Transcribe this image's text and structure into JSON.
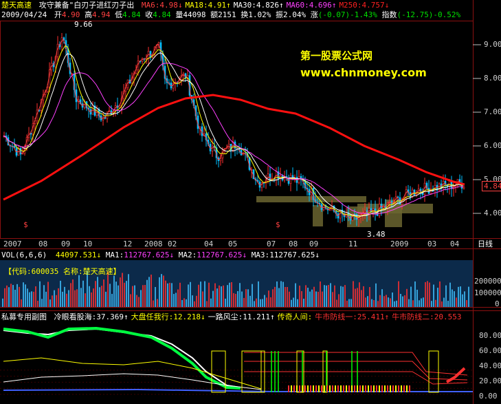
{
  "header": {
    "stock_name": "楚天高速",
    "strategy": "攻守兼备\"白刃子进红刃子出",
    "ma": [
      {
        "label": "MA6",
        "value": "4.98",
        "arrow": "↓",
        "color": "#ff4040"
      },
      {
        "label": "MA18",
        "value": "4.91",
        "arrow": "↑",
        "color": "#ffff00"
      },
      {
        "label": "MA30",
        "value": "4.826",
        "arrow": "↑",
        "color": "#ffffff"
      },
      {
        "label": "MA60",
        "value": "4.696",
        "arrow": "↑",
        "color": "#ff40ff"
      },
      {
        "label": "M250",
        "value": "4.757",
        "arrow": "↓",
        "color": "#ff2020"
      }
    ]
  },
  "quote": {
    "date": "2009/04/24",
    "open_label": "开",
    "open": "4.90",
    "high_label": "高",
    "high": "4.94",
    "low_label": "低",
    "low": "4.84",
    "close_label": "收",
    "close": "4.84",
    "vol_label": "量",
    "vol": "44098",
    "amt_label": "额",
    "amt": "2151",
    "turn_label": "换",
    "turn": "1.02%",
    "amp_label": "振",
    "amp": "2.04%",
    "chg_label": "涨",
    "chg": "(-0.07)-1.43%",
    "idx_label": "指数",
    "idx": "(-12.75)-0.52%"
  },
  "watermark": {
    "line1": "第一股票公式网",
    "line2": "www.chnmoney.com"
  },
  "price_axis": {
    "ticks": [
      "9.00",
      "8.00",
      "7.00",
      "6.00",
      "5.00",
      "4.00"
    ],
    "current": "4.84",
    "high_marker": "9.66",
    "low_marker": "3.48",
    "dollar_marker": "$"
  },
  "time_axis": {
    "labels": [
      "2007",
      "08",
      "09",
      "10",
      "12",
      "2008",
      "02",
      "04",
      "05",
      "07",
      "08",
      "09",
      "11",
      "2009",
      "03",
      "04"
    ],
    "period": "日线"
  },
  "volume": {
    "header_label": "VOL(6,6,6)",
    "value": "44097.531",
    "ma1_label": "MA1:",
    "ma1": "112767.625",
    "ma2_label": "MA2:",
    "ma2": "112767.625",
    "ma3_label": "MA3:",
    "ma3": "112767.625",
    "info": "【代码:600035 名称:楚天高速】",
    "axis": [
      "200000",
      "100000",
      "0"
    ]
  },
  "subchart": {
    "title": "私募专用副图",
    "items": [
      {
        "label": "冷眼看股海",
        "value": "37.369",
        "arrow": "↑",
        "color": "#ffffff"
      },
      {
        "label": "大盘任我行",
        "value": "12.218",
        "arrow": "↓",
        "color": "#ffff00"
      },
      {
        "label": "一路风尘",
        "value": "11.211",
        "arrow": "↑",
        "color": "#ffffff"
      },
      {
        "label": "传奇人间",
        "value": "",
        "arrow": "",
        "color": "#ffff00"
      },
      {
        "label": "牛市防线一",
        "value": "25.411",
        "arrow": "↑",
        "color": "#ff3030"
      },
      {
        "label": "牛市防线二",
        "value": "20.553",
        "arrow": "",
        "color": "#ff3030"
      }
    ],
    "axis": [
      "80.00",
      "60.00",
      "40.00",
      "20.00",
      "0.00"
    ]
  },
  "colors": {
    "ma250": "#ff1010",
    "up_candle": "#ff3030",
    "down_candle": "#00c0ff",
    "volume_bg": "#0c2a4a",
    "grid": "#8b1010"
  }
}
